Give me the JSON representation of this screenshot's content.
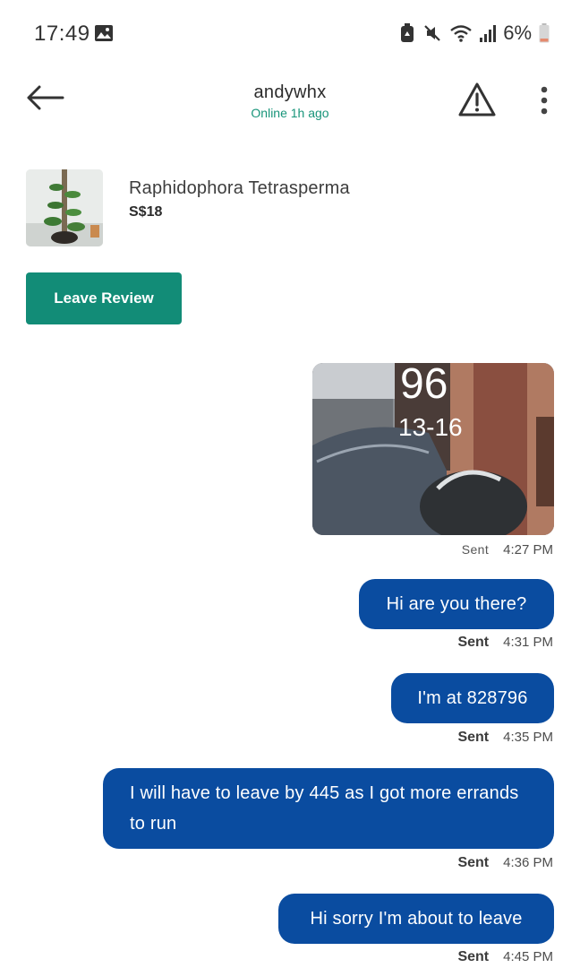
{
  "status_bar": {
    "time": "17:49",
    "battery": "6%",
    "icons": [
      "gallery-icon",
      "battery-saver-icon",
      "mute-icon",
      "wifi-icon",
      "signal-icon",
      "battery-icon"
    ]
  },
  "header": {
    "username": "andywhx",
    "online_status": "Online 1h ago",
    "icons": [
      "back-arrow-icon",
      "warning-icon",
      "more-vertical-icon"
    ]
  },
  "listing": {
    "title": "Raphidophora Tetrasperma",
    "price": "S$18"
  },
  "leave_review_label": "Leave Review",
  "messages": [
    {
      "type": "photo",
      "caption_overlay": [
        "96",
        "13-16"
      ],
      "status": "Sent",
      "time": "4:27 PM"
    },
    {
      "type": "text",
      "text": "Hi are you there?",
      "status": "Sent",
      "time": "4:31 PM"
    },
    {
      "type": "text",
      "text": "I'm at 828796",
      "status": "Sent",
      "time": "4:35 PM"
    },
    {
      "type": "text",
      "text": "I will have to leave by 445 as I got more errands to run",
      "status": "Sent",
      "time": "4:36 PM"
    },
    {
      "type": "text",
      "text": "Hi sorry I'm about to leave",
      "status": "Sent",
      "time": "4:45 PM"
    }
  ],
  "colors": {
    "accent_green": "#128c77",
    "online_green": "#179479",
    "bubble_blue": "#0a4ca0"
  }
}
